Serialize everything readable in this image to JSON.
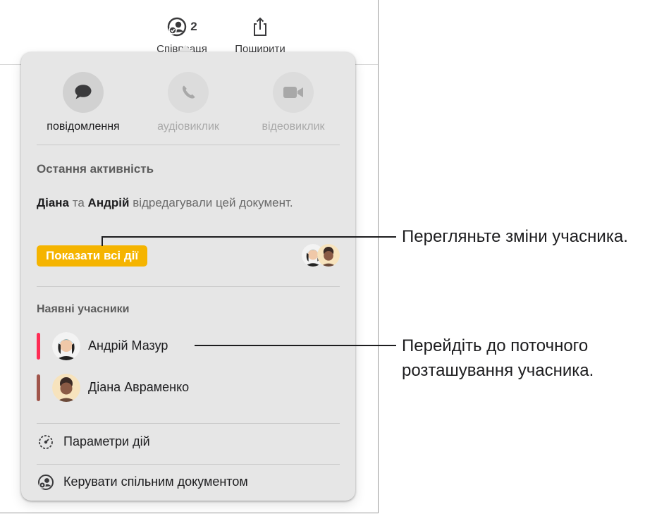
{
  "toolbar": {
    "collaborate": {
      "count": "2",
      "label": "Співпраця",
      "icon": "collaborate-icon"
    },
    "share": {
      "label": "Поширити",
      "icon": "share-icon"
    }
  },
  "popover": {
    "actions": [
      {
        "label": "повідомлення",
        "icon": "message-bubble-icon",
        "enabled": true
      },
      {
        "label": "аудіовиклик",
        "icon": "phone-icon",
        "enabled": false
      },
      {
        "label": "відеовиклик",
        "icon": "video-camera-icon",
        "enabled": false
      }
    ],
    "recent_activity": {
      "title": "Остання активність",
      "name1": "Діана",
      "conj": "та",
      "name2": "Андрій",
      "text": "відредагували цей документ.",
      "button_label": "Показати всі дії"
    },
    "participants": {
      "title": "Наявні учасники",
      "items": [
        {
          "name": "Андрій Мазур",
          "color": "#ff2d55"
        },
        {
          "name": "Діана Авраменко",
          "color": "#a0554b"
        }
      ]
    },
    "menu": {
      "activity_settings": "Параметри дій",
      "manage_shared": "Керувати спільним документом"
    }
  },
  "callouts": {
    "changes": "Перегляньте зміни учасника.",
    "location": "Перейдіть до поточного розташування учасника."
  },
  "colors": {
    "highlight": "#f5b400",
    "popover_bg": "#e6e6e6"
  }
}
